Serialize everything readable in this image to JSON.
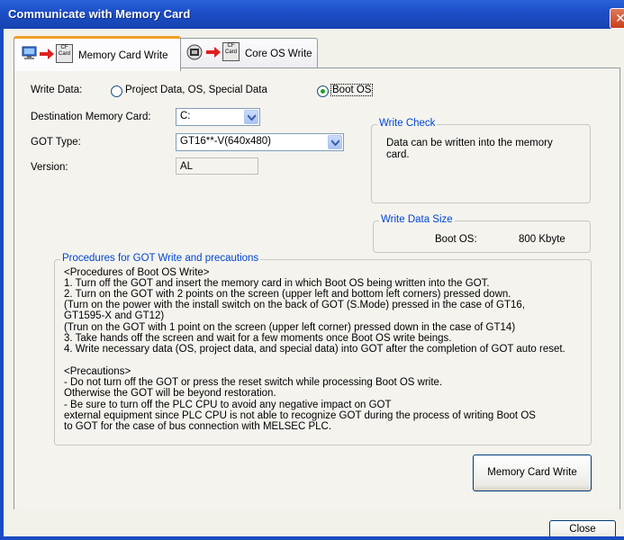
{
  "window": {
    "title": "Communicate with Memory Card",
    "close_glyph": "✕"
  },
  "tabs": [
    {
      "label": "Memory Card Write",
      "active": true
    },
    {
      "label": "Core OS Write",
      "active": false
    }
  ],
  "icons": {
    "cf_card_text": "CF Card"
  },
  "form": {
    "write_data_label": "Write Data:",
    "write_data_options": [
      {
        "label": "Project Data, OS, Special Data",
        "checked": false
      },
      {
        "label": "Boot OS",
        "checked": true
      }
    ],
    "destination_label": "Destination Memory Card:",
    "destination_value": "C:",
    "got_type_label": "GOT Type:",
    "got_type_value": "GT16**-V(640x480)",
    "version_label": "Version:",
    "version_value": "AL"
  },
  "write_check": {
    "legend": "Write Check",
    "lines": [
      "Data can be written into the memory",
      "card."
    ]
  },
  "write_data_size": {
    "legend": "Write Data Size",
    "label": "Boot OS:",
    "value": "800 Kbyte"
  },
  "procedures": {
    "legend": "Procedures for GOT Write and precautions",
    "lines": [
      "<Procedures of Boot OS Write>",
      "1. Turn off the GOT and insert the memory card in which Boot OS being written into the GOT.",
      "2. Turn on the GOT with 2 points on the screen (upper left and bottom left corners) pressed down.",
      "   (Turn on the power with the install switch on the back of GOT (S.Mode) pressed in the case of GT16,",
      "GT1595-X and GT12)",
      "   (Trun on the GOT with 1 point on the screen (upper left corner) pressed down in the case of GT14)",
      "3. Take hands off the screen and wait for a few moments once Boot OS write beings.",
      "4. Write necessary data (OS, project data, and special data) into GOT after the completion of GOT auto reset.",
      "",
      "<Precautions>",
      "- Do not turn off the GOT or press the reset switch while processing Boot OS write.",
      "  Otherwise the GOT will be beyond restoration.",
      "- Be sure to turn off the PLC CPU to avoid any negative impact on GOT",
      "  external equipment since PLC CPU is not able to recognize GOT during the process of writing Boot OS",
      "  to GOT for the case of bus connection with MELSEC PLC."
    ]
  },
  "buttons": {
    "write": "Memory Card Write",
    "close": "Close"
  }
}
